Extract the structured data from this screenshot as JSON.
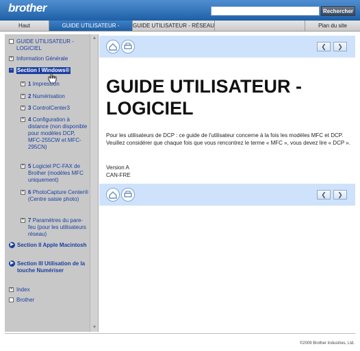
{
  "header": {
    "logo": "brother",
    "search_placeholder": "",
    "search_button": "Rechercher"
  },
  "tabs": [
    {
      "label": "Haut"
    },
    {
      "label": "GUIDE UTILISATEUR - LOGICIEL"
    },
    {
      "label": "GUIDE UTILISATEUR - RÉSEAU"
    },
    {
      "label": "Plan du site"
    }
  ],
  "sidebar": {
    "items": [
      {
        "label": "GUIDE UTILISATEUR - LOGICIEL"
      },
      {
        "label": "Information Générale"
      },
      {
        "label": "Section I Windows®"
      },
      {
        "num": "1",
        "label": "Impression"
      },
      {
        "num": "2",
        "label": "Numérisation"
      },
      {
        "num": "3",
        "label": "ControlCenter3"
      },
      {
        "num": "4",
        "label": "Configuration à distance (non disponible pour modèles DCP, MFC-255CW et MFC-295CN)"
      },
      {
        "num": "5",
        "label": "Logiciel PC-FAX de Brother (modèles MFC uniquement)"
      },
      {
        "num": "6",
        "label": "PhotoCapture Center® (Centre saisie photo)"
      },
      {
        "num": "7",
        "label": "Paramètres du pare-feu (pour les utilisateurs réseau)"
      },
      {
        "label": "Section II Apple Macintosh"
      },
      {
        "label": "Section III Utilisation de la touche Numériser"
      },
      {
        "label": "Index"
      },
      {
        "label": "Brother"
      }
    ]
  },
  "main": {
    "title_line1": "GUIDE UTILISATEUR -",
    "title_line2": "LOGICIEL",
    "paragraph": "Pour les utilisateurs de DCP : ce guide de l'utilisateur concerne à la fois les modèles MFC et DCP. Veuillez considérer que chaque fois que vous rencontrez le terme « MFC », vous devez lire « DCP ».",
    "version": "Version A",
    "region": "CAN-FRE"
  },
  "footer": {
    "copyright": "©2009 Brother Industries, Ltd."
  },
  "colors": {
    "header_blue": "#1f5fa6",
    "band_blue": "#cfe2fb",
    "link_blue": "#1a3fa0",
    "sidebar_gray": "#c8c8c8"
  }
}
